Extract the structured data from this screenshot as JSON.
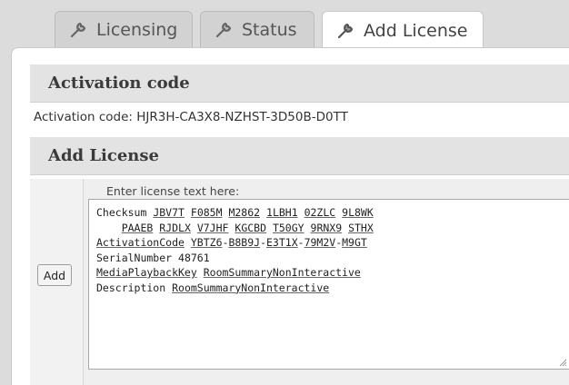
{
  "tabs": [
    {
      "label": "Licensing",
      "icon": "wrench-icon",
      "active": false
    },
    {
      "label": "Status",
      "icon": "wrench-icon",
      "active": false
    },
    {
      "label": "Add License",
      "icon": "wrench-icon",
      "active": true
    }
  ],
  "activation": {
    "header": "Activation code",
    "label": "Activation code:",
    "code": "HJR3H-CA3X8-NZHST-3D50B-D0TT"
  },
  "add_license": {
    "header": "Add License",
    "prompt": "Enter license text here:",
    "button_label": "Add",
    "text_lines": [
      "Checksum JBV7T F085M M2862 1LBH1 02ZLC 9L8WK",
      "    PAAEB RJDLX V7JHF KGCBD T50GY 9RNX9 STHX",
      "ActivationCode YBTZ6-B8B9J-E3T1X-79M2V-M9GT",
      "SerialNumber 48761",
      "MediaPlaybackKey RoomSummaryNonInteractive",
      "Description RoomSummaryNonInteractive"
    ]
  },
  "colors": {
    "background": "#dcdcdc",
    "section_header": "#e3e3e3",
    "panel": "#ffffff"
  }
}
